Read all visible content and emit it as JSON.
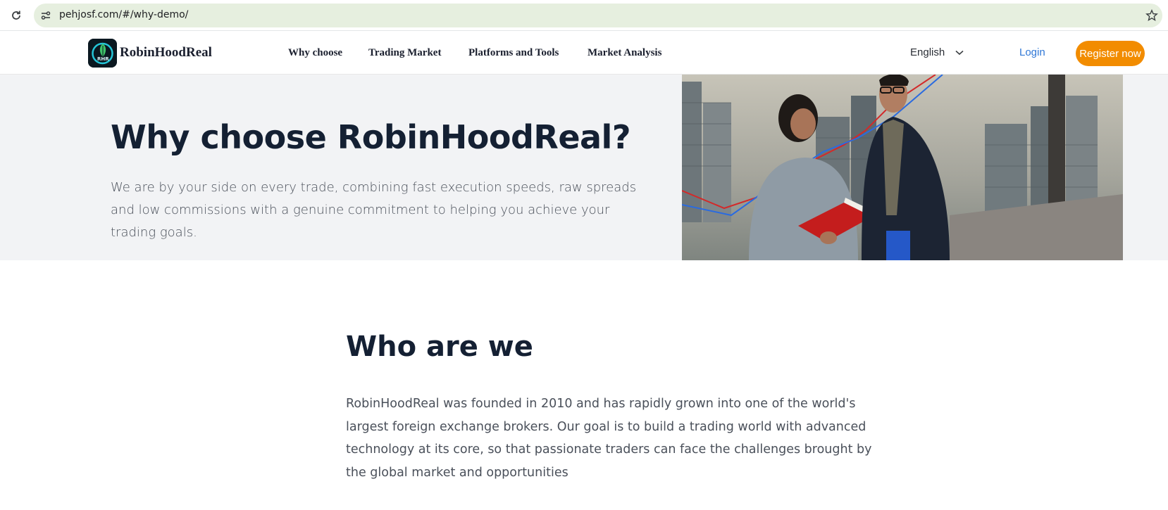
{
  "browser": {
    "url": "pehjosf.com/#/why-demo/",
    "reload_icon": "reload-icon",
    "site_info_icon": "site-info-icon",
    "bookmark_icon": "star-icon"
  },
  "header": {
    "brand": "RobinHoodReal",
    "logo_text": "RHR",
    "nav": [
      "Why choose",
      "Trading Market",
      "Platforms and Tools",
      "Market Analysis"
    ],
    "language": "English",
    "login": "Login",
    "register": "Register now",
    "accent_color": "#f28c00",
    "link_color": "#2f77d6"
  },
  "hero": {
    "title": "Why choose RobinHoodReal?",
    "text": "We are by your side on every trade, combining fast execution speeds, raw spreads and low commissions with a genuine commitment to helping you achieve your trading goals."
  },
  "about": {
    "title": "Who are we",
    "text": "RobinHoodReal was founded in 2010 and has rapidly grown into one of the world's largest foreign exchange brokers. Our goal is to build a trading world with advanced technology at its core, so that passionate traders can face the challenges brought by the global market and opportunities"
  }
}
